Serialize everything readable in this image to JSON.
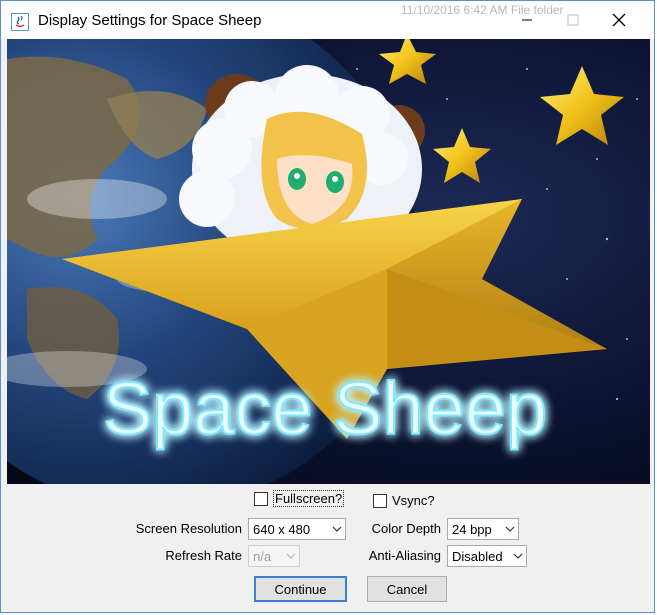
{
  "window": {
    "title": "Display Settings for Space Sheep",
    "behind_text": "11/10/2016 6:42 AM    File folder"
  },
  "banner": {
    "logo_text": "Space Sheep",
    "description_icon": "space-sheep-banner"
  },
  "options": {
    "fullscreen_label": "Fullscreen?",
    "fullscreen_checked": false,
    "vsync_label": "Vsync?",
    "vsync_checked": false
  },
  "fields": {
    "screen_resolution_label": "Screen Resolution",
    "screen_resolution_value": "640 x 480",
    "refresh_rate_label": "Refresh Rate",
    "refresh_rate_value": "n/a",
    "color_depth_label": "Color Depth",
    "color_depth_value": "24 bpp",
    "anti_aliasing_label": "Anti-Aliasing",
    "anti_aliasing_value": "Disabled"
  },
  "buttons": {
    "continue_label": "Continue",
    "cancel_label": "Cancel"
  },
  "colors": {
    "accent": "#3c7fd1",
    "logo_glow": "#7fe8ff",
    "star": "#f2c21b"
  }
}
